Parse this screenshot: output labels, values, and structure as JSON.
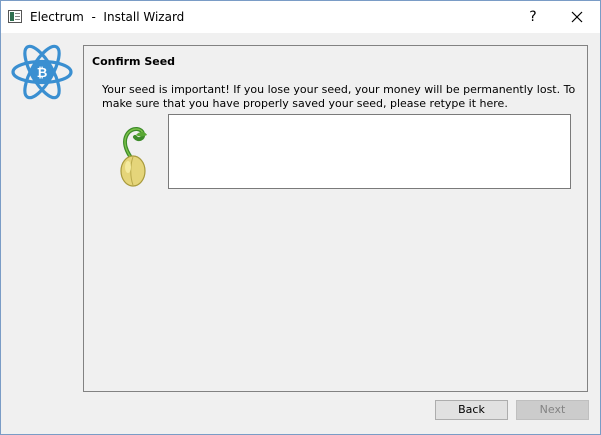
{
  "window": {
    "title": "Electrum  -  Install Wizard",
    "help_label": "?",
    "app_icon": "electrum-window-icon",
    "close_icon": "close-icon"
  },
  "logo": {
    "icon": "electrum-bitcoin-atom-logo",
    "color": "#3a8fd1"
  },
  "panel": {
    "title": "Confirm Seed",
    "message": "Your seed is important! If you lose your seed, your money will be permanently lost. To make sure that you have properly saved your seed, please retype it here.",
    "seed_icon": "sprouting-seed-icon"
  },
  "seed_input": {
    "value": "",
    "placeholder": ""
  },
  "buttons": {
    "back_label": "Back",
    "next_label": "Next",
    "next_enabled": false
  }
}
